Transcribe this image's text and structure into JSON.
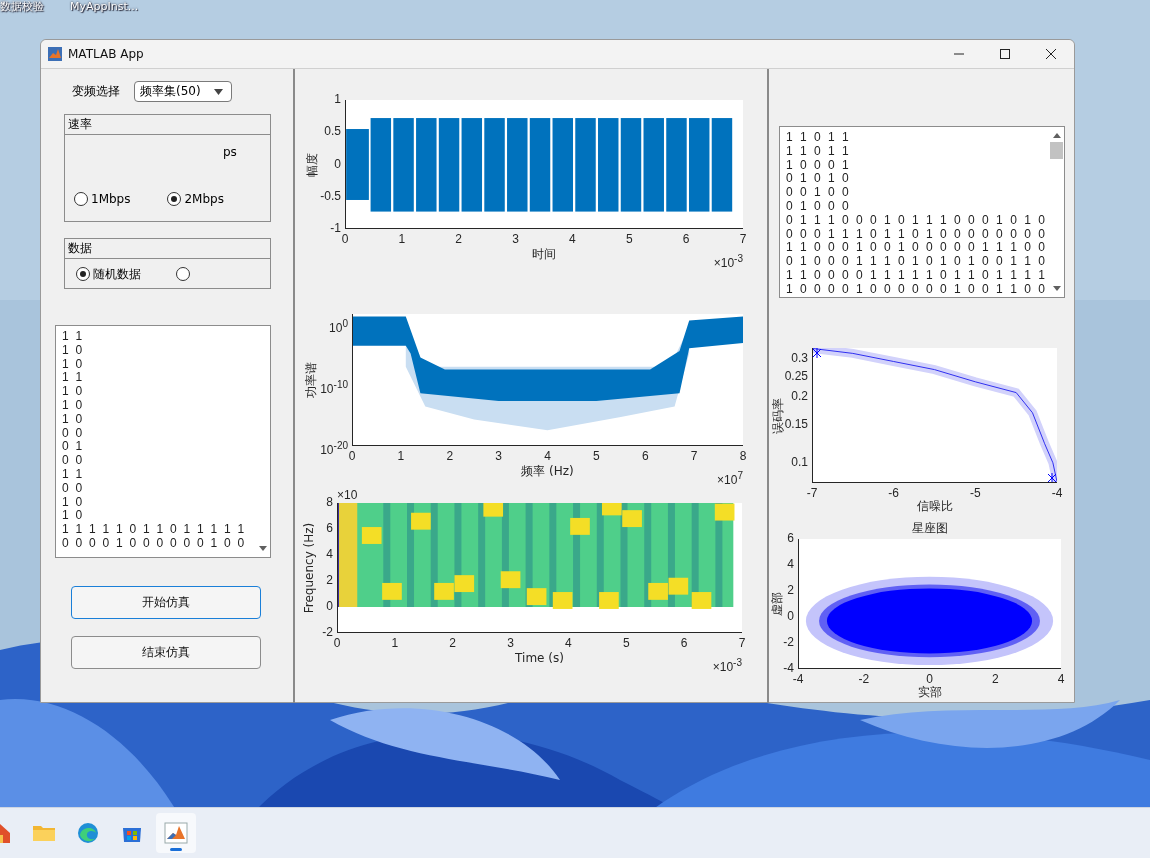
{
  "desktop": {
    "icons": [
      {
        "label": "数据校验"
      },
      {
        "label": "MyAppInst..."
      }
    ]
  },
  "window": {
    "title": "MATLAB App"
  },
  "left_panel": {
    "dropdown": {
      "label": "变频选择",
      "value": "频率集(50)"
    },
    "rate_group": {
      "title": "速率",
      "fragment": "ps",
      "options": [
        {
          "label": "1Mbps",
          "selected": false
        },
        {
          "label": "2Mbps",
          "selected": true
        }
      ]
    },
    "data_group": {
      "title": "数据",
      "options": [
        {
          "label": "随机数据",
          "selected": true
        },
        {
          "selected": false
        }
      ]
    },
    "table": {
      "rows": [
        "1 1",
        "1 0",
        "1 0",
        "1 1",
        "1 0",
        "1 0",
        "1 0",
        "0 0",
        "0 1",
        "0 0",
        "1 1",
        "0 0",
        "1 0",
        "1 0",
        "1 1 1 1 1 0 1 1 0 1 1 1 1 1",
        "0 0 0 0 1 0 0 0 0 0 0 1 0 0"
      ]
    },
    "buttons": [
      {
        "label": "开始仿真",
        "focused": true
      },
      {
        "label": "结束仿真",
        "focused": false
      }
    ]
  },
  "middle_panel": {
    "plots": [
      {
        "kind": "waveform",
        "ylabel": "幅度",
        "xlabel": "时间",
        "xticks": [
          "0",
          "1",
          "2",
          "3",
          "4",
          "5",
          "6",
          "7"
        ],
        "yticks": [
          "1",
          "0.5",
          "0",
          "-0.5",
          "-1"
        ],
        "exponent": "×10$^{-3}$"
      },
      {
        "kind": "spectrum",
        "ylabel": "功率谱",
        "xlabel": "频率 (Hz)",
        "xticks": [
          "0",
          "1",
          "2",
          "3",
          "4",
          "5",
          "6",
          "7",
          "8"
        ],
        "yticks": [
          "10$^{0}$",
          "10$^{-10}$",
          "10$^{-20}$"
        ],
        "exponent": "×10$^{7}$"
      },
      {
        "kind": "spectrogram",
        "ylabel": "Frequency (Hz)",
        "xlabel": "Time (s)",
        "xticks": [
          "0",
          "1",
          "2",
          "3",
          "4",
          "5",
          "6",
          "7"
        ],
        "yticks": [
          "8",
          "6",
          "4",
          "2",
          "0",
          "-2"
        ],
        "exponent": "×10$^{-3}$",
        "y_exponent": "×10"
      }
    ]
  },
  "right_panel": {
    "table": {
      "rows": [
        "1 1 0 1 1",
        "1 1 0 1 1",
        "1 0 0 0 1",
        "0 1 0 1 0",
        "0 0 1 0 0",
        "0 1 0 0 0",
        "0 1 1 1 0 0 0 1 0 1 1 1 0 0 0 1 0 1 0",
        "0 0 0 1 1 1 0 1 1 0 1 0 0 0 0 0 0 0 0",
        "1 1 0 0 0 1 0 0 1 0 0 0 0 0 1 1 1 0 0",
        "0 1 0 0 0 1 1 1 0 1 0 1 0 1 0 0 1 1 0",
        "1 1 0 0 0 0 1 1 1 1 1 0 1 1 0 1 1 1 1",
        "1 0 0 0 0 1 0 0 0 0 0 0 1 0 0 1 1 0 0"
      ]
    },
    "plots": [
      {
        "kind": "ber",
        "ylabel": "误码率",
        "xlabel": "信噪比",
        "xticks": [
          "-7",
          "-6",
          "-5",
          "-4"
        ],
        "yticks": [
          "0.3",
          "0.25",
          "0.2",
          "0.15",
          "0.1"
        ]
      },
      {
        "kind": "constellation",
        "title": "星座图",
        "ylabel": "虚部",
        "xlabel": "实部",
        "xticks": [
          "-4",
          "-2",
          "0",
          "2",
          "4"
        ],
        "yticks": [
          "6",
          "4",
          "2",
          "0",
          "-2",
          "-4"
        ]
      }
    ]
  },
  "taskbar": {
    "apps": [
      {
        "kind": "app",
        "active": false
      },
      {
        "kind": "files",
        "active": false
      },
      {
        "kind": "browser",
        "active": false
      },
      {
        "kind": "store",
        "active": false
      },
      {
        "kind": "matlab",
        "active": true
      }
    ]
  }
}
